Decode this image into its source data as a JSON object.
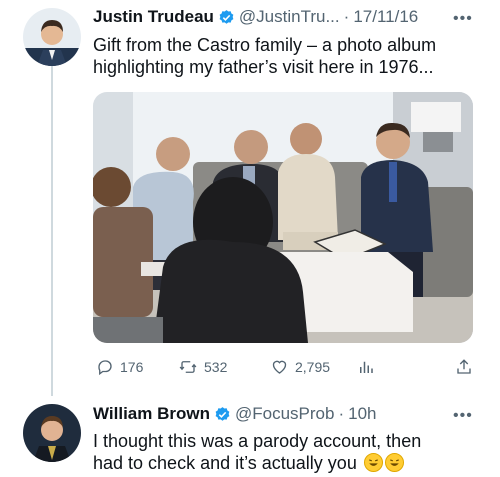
{
  "tweet": {
    "author_name": "Justin Trudeau",
    "handle": "@JustinTru...",
    "separator": "·",
    "date": "17/11/16",
    "more": "•••",
    "text_line1": "Gift from the Castro family – a photo album",
    "text_line2": "highlighting my father’s visit here in 1976...",
    "stats": {
      "replies": "176",
      "retweets": "532",
      "likes": "2,795"
    }
  },
  "reply": {
    "author_name": "William Brown",
    "handle": "@FocusProb",
    "separator": "·",
    "time": "10h",
    "more": "•••",
    "text_line1": "I thought this was a parody  account, then",
    "text_line2": "had to check and it’s actually you",
    "emoji_count": 2
  },
  "icons": {
    "verified": "verified-badge-icon",
    "reply": "reply-icon",
    "retweet": "retweet-icon",
    "like": "heart-icon",
    "views": "views-icon",
    "share": "share-icon"
  },
  "colors": {
    "verified": "#1d9bf0",
    "secondary_text": "#536471",
    "thread_line": "#cfd9de"
  }
}
